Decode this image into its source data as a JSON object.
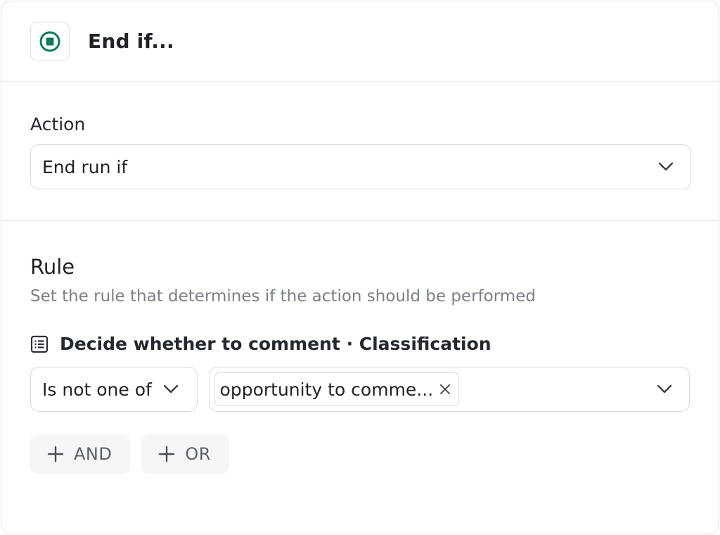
{
  "header": {
    "title": "End if...",
    "icon": "stop-circle-icon",
    "accent": "#0f7a5c"
  },
  "action": {
    "label": "Action",
    "value": "End run if"
  },
  "rule": {
    "title": "Rule",
    "description": "Set the rule that determines if the action should be performed",
    "source": "Decide whether to comment · Classification",
    "operator": "Is not one of",
    "values": [
      "opportunity to comme..."
    ]
  },
  "buttons": {
    "and": "AND",
    "or": "OR"
  }
}
